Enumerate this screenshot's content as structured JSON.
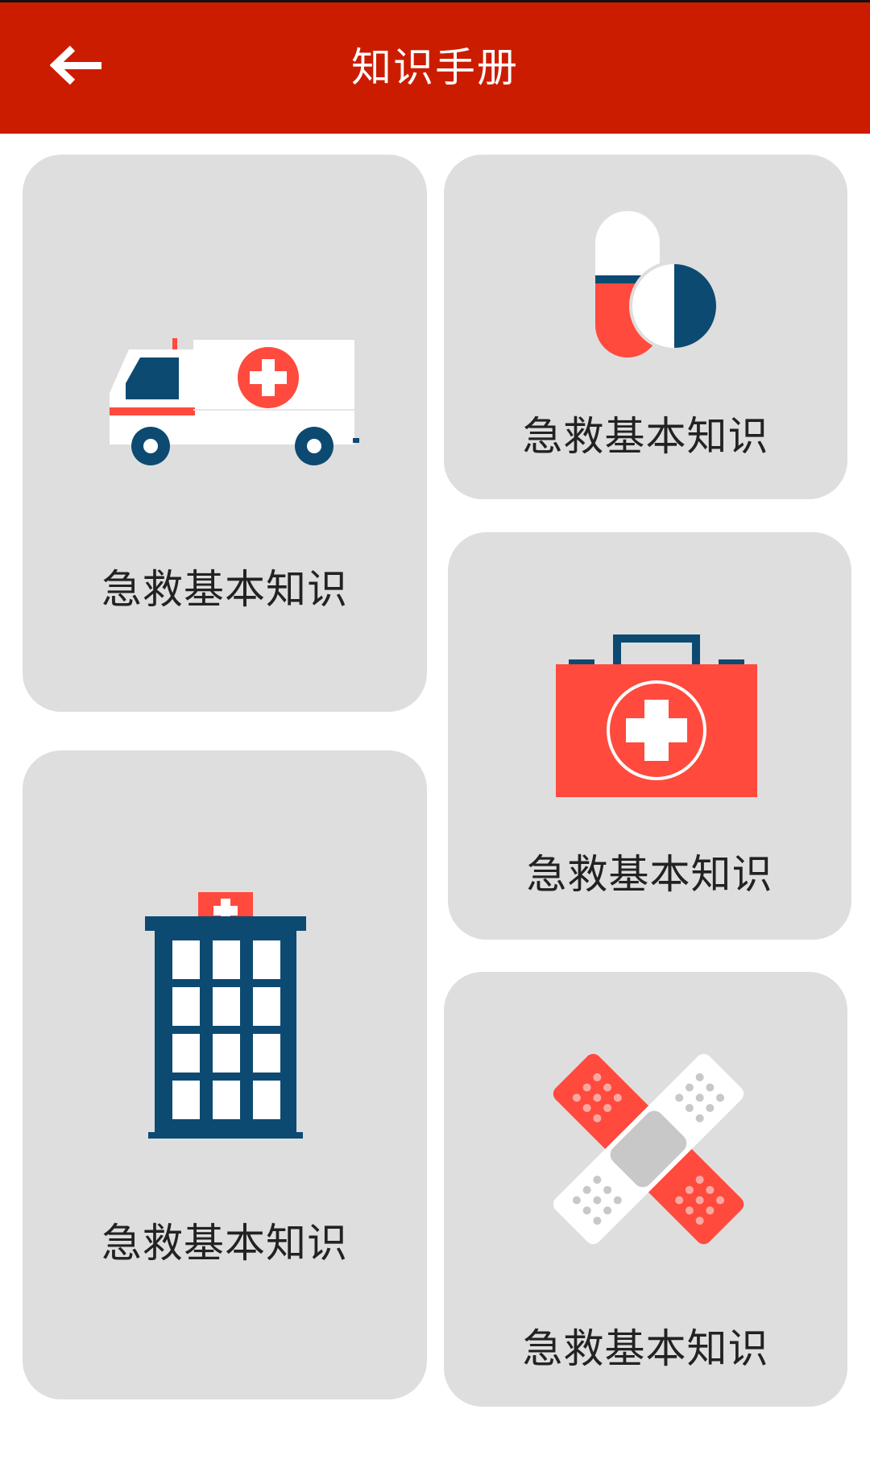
{
  "header": {
    "title": "知识手册",
    "back_icon": "arrow-left-icon"
  },
  "colors": {
    "header_bg": "#cc1c00",
    "card_bg": "#dedede",
    "accent_red": "#ff4a3d",
    "accent_navy": "#0c4a72"
  },
  "cards": [
    {
      "icon": "ambulance-icon",
      "label": "急救基本知识"
    },
    {
      "icon": "pills-icon",
      "label": "急救基本知识"
    },
    {
      "icon": "first-aid-kit-icon",
      "label": "急救基本知识"
    },
    {
      "icon": "hospital-icon",
      "label": "急救基本知识"
    },
    {
      "icon": "bandage-icon",
      "label": "急救基本知识"
    }
  ]
}
